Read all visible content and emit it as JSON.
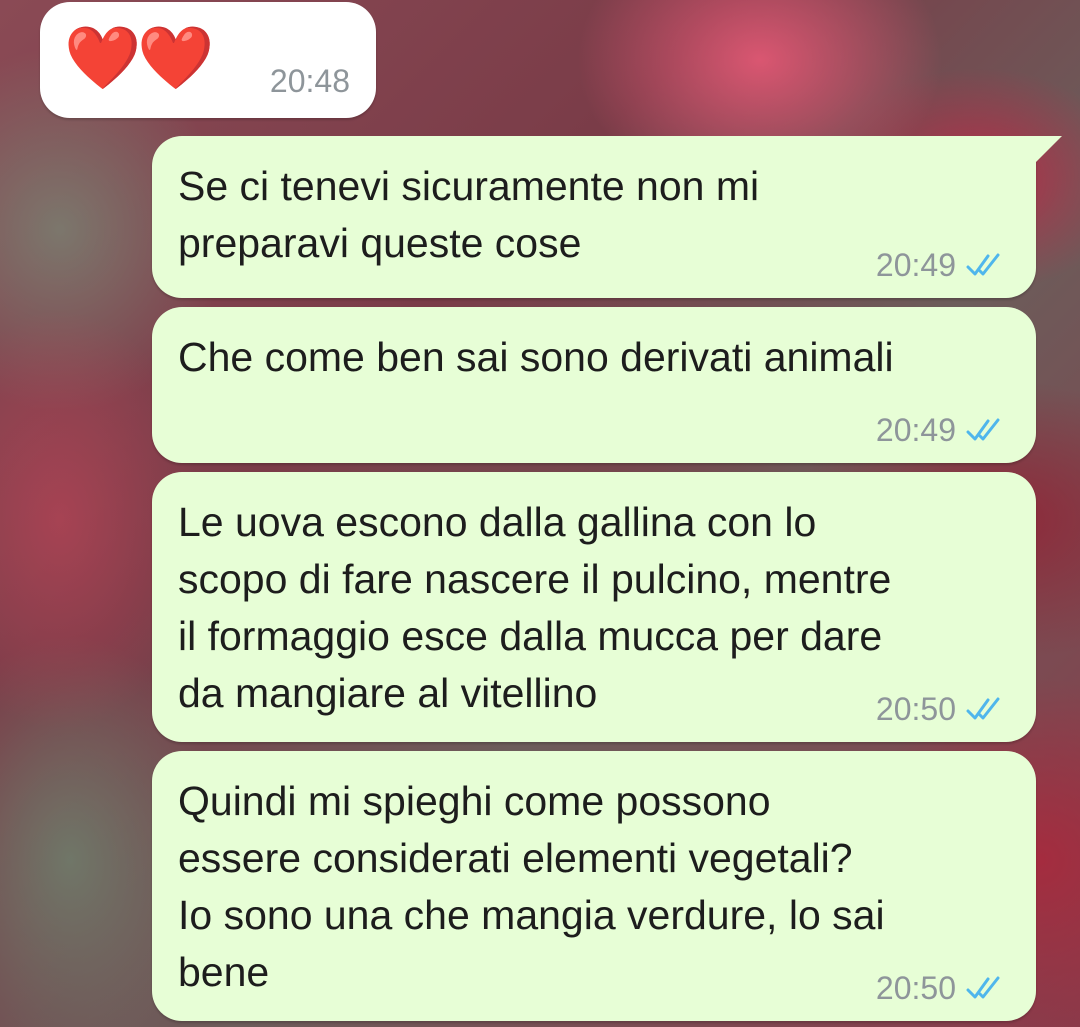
{
  "messages": [
    {
      "direction": "incoming",
      "text": "❤️❤️",
      "time": "20:48"
    },
    {
      "direction": "outgoing",
      "text": "Se ci tenevi sicuramente non mi\npreparavi queste cose",
      "time": "20:49",
      "status_icon": "double-check-read-icon"
    },
    {
      "direction": "outgoing",
      "text": "Che come ben sai sono derivati animali",
      "time": "20:49",
      "status_icon": "double-check-read-icon"
    },
    {
      "direction": "outgoing",
      "text": "Le uova escono dalla gallina con lo\nscopo di fare nascere il pulcino, mentre\nil formaggio esce dalla mucca per dare\nda mangiare al vitellino",
      "time": "20:50",
      "status_icon": "double-check-read-icon"
    },
    {
      "direction": "outgoing",
      "text": "Quindi mi spieghi come possono\nessere considerati elementi vegetali?\nIo sono una che mangia verdure, lo sai\nbene",
      "time": "20:50",
      "status_icon": "double-check-read-icon"
    }
  ],
  "colors": {
    "incoming_bubble": "#ffffff",
    "outgoing_bubble": "#e7fed6",
    "read_tick": "#4fb6ec",
    "timestamp": "#8e959a"
  }
}
